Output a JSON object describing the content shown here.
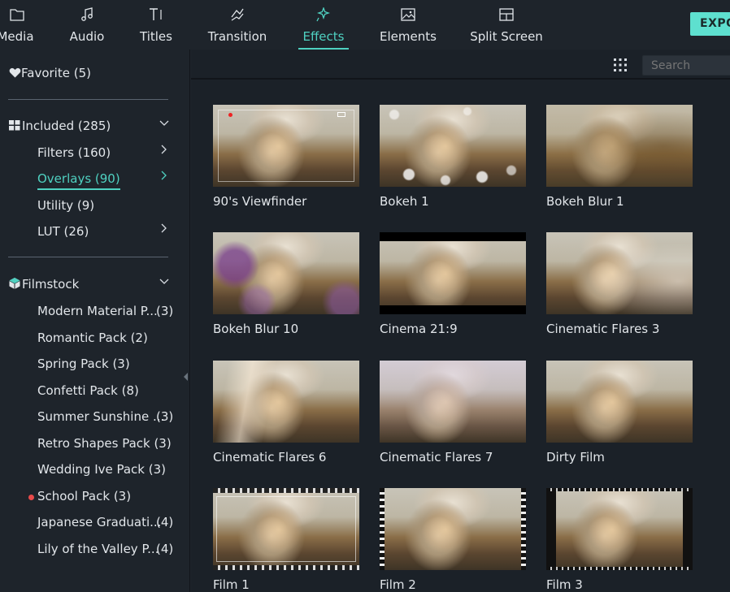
{
  "tabs": [
    {
      "label": "Media",
      "icon": "folder-icon"
    },
    {
      "label": "Audio",
      "icon": "music-note-icon"
    },
    {
      "label": "Titles",
      "icon": "text-cursor-icon"
    },
    {
      "label": "Transition",
      "icon": "transition-icon"
    },
    {
      "label": "Effects",
      "icon": "effects-sparkle-icon",
      "active": true
    },
    {
      "label": "Elements",
      "icon": "image-icon"
    },
    {
      "label": "Split Screen",
      "icon": "split-screen-icon"
    }
  ],
  "export_label": "EXPO",
  "accent_color": "#4fd1c1",
  "sidebar": {
    "favorite": {
      "label": "Favorite",
      "count": "(5)"
    },
    "included": {
      "label": "Included",
      "count": "(285)"
    },
    "included_items": [
      {
        "label": "Filters (160)",
        "has_arrow": true
      },
      {
        "label": "Overlays (90)",
        "has_arrow": true,
        "active": true
      },
      {
        "label": "Utility (9)",
        "has_arrow": false
      },
      {
        "label": "LUT (26)",
        "has_arrow": true
      }
    ],
    "filmstock": {
      "label": "Filmstock"
    },
    "filmstock_items": [
      {
        "label": "Modern Material P...",
        "count": "(3)"
      },
      {
        "label": "Romantic Pack (2)",
        "count": ""
      },
      {
        "label": "Spring Pack (3)",
        "count": ""
      },
      {
        "label": "Confetti Pack (8)",
        "count": ""
      },
      {
        "label": "Summer Sunshine ...",
        "count": "(3)"
      },
      {
        "label": "Retro Shapes Pack (3)",
        "count": ""
      },
      {
        "label": "Wedding Ive Pack (3)",
        "count": ""
      },
      {
        "label": "School Pack (3)",
        "count": "",
        "new_dot": true
      },
      {
        "label": "Japanese Graduati...",
        "count": "(4)"
      },
      {
        "label": "Lily of the Valley P...",
        "count": "(4)"
      }
    ]
  },
  "search": {
    "placeholder": "Search"
  },
  "effects": [
    {
      "name": "90's Viewfinder",
      "style": "viewfinder"
    },
    {
      "name": "Bokeh 1",
      "style": "bokeh"
    },
    {
      "name": "Bokeh Blur 1",
      "style": "bokehblur"
    },
    {
      "name": "Bokeh Blur 10",
      "style": "purple"
    },
    {
      "name": "Cinema 21:9",
      "style": "cinema"
    },
    {
      "name": "Cinematic Flares 3",
      "style": "flare"
    },
    {
      "name": "Cinematic Flares 6",
      "style": "flare6"
    },
    {
      "name": "Cinematic Flares 7",
      "style": "flare7"
    },
    {
      "name": "Dirty Film",
      "style": "plain"
    },
    {
      "name": "Film 1",
      "style": "film1"
    },
    {
      "name": "Film 2",
      "style": "film2"
    },
    {
      "name": "Film 3",
      "style": "film3"
    }
  ]
}
